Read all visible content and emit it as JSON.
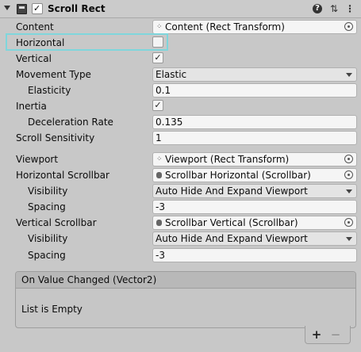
{
  "header": {
    "title": "Scroll Rect",
    "enabled": true
  },
  "rows": {
    "content": {
      "label": "Content",
      "value": "Content (Rect Transform)"
    },
    "horizontal": {
      "label": "Horizontal",
      "checked": false
    },
    "vertical": {
      "label": "Vertical",
      "checked": true
    },
    "movement_type": {
      "label": "Movement Type",
      "value": "Elastic"
    },
    "elasticity": {
      "label": "Elasticity",
      "value": "0.1"
    },
    "inertia": {
      "label": "Inertia",
      "checked": true
    },
    "deceleration_rate": {
      "label": "Deceleration Rate",
      "value": "0.135"
    },
    "scroll_sensitivity": {
      "label": "Scroll Sensitivity",
      "value": "1"
    },
    "viewport": {
      "label": "Viewport",
      "value": "Viewport (Rect Transform)"
    },
    "horizontal_scrollbar": {
      "label": "Horizontal Scrollbar",
      "value": "Scrollbar Horizontal (Scrollbar)"
    },
    "h_visibility": {
      "label": "Visibility",
      "value": "Auto Hide And Expand Viewport"
    },
    "h_spacing": {
      "label": "Spacing",
      "value": "-3"
    },
    "vertical_scrollbar": {
      "label": "Vertical Scrollbar",
      "value": "Scrollbar Vertical (Scrollbar)"
    },
    "v_visibility": {
      "label": "Visibility",
      "value": "Auto Hide And Expand Viewport"
    },
    "v_spacing": {
      "label": "Spacing",
      "value": "-3"
    }
  },
  "event": {
    "title": "On Value Changed (Vector2)",
    "empty_text": "List is Empty",
    "add": "+",
    "remove": "−"
  },
  "icons": {
    "check": "✓",
    "rect_transform": "⁘",
    "help": "?",
    "sliders": "⇅",
    "kebab": "⋮"
  },
  "colors": {
    "highlight": "#7fd6dc",
    "background": "#c8c8c8"
  }
}
